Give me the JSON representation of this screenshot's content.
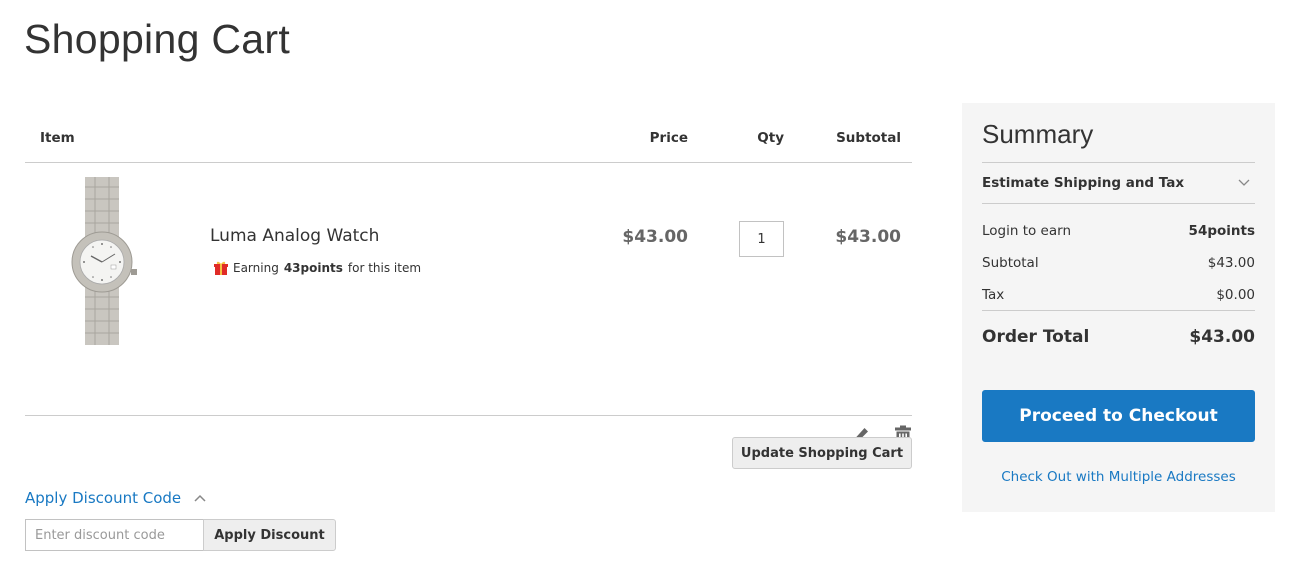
{
  "page": {
    "title": "Shopping Cart"
  },
  "cart": {
    "headers": {
      "item": "Item",
      "price": "Price",
      "qty": "Qty",
      "subtotal": "Subtotal"
    },
    "items": [
      {
        "name": "Luma Analog Watch",
        "image_alt": "Luma Analog Watch",
        "earn_prefix": "Earning",
        "earn_points": "43points",
        "earn_suffix": "for this item",
        "price": "$43.00",
        "qty": "1",
        "subtotal": "$43.00",
        "actions": {
          "edit_icon": "pencil-icon",
          "delete_icon": "trash-icon"
        }
      }
    ],
    "update_button": "Update Shopping Cart"
  },
  "discount": {
    "title": "Apply Discount Code",
    "expanded": true,
    "placeholder": "Enter discount code",
    "value": "",
    "apply_button": "Apply Discount"
  },
  "summary": {
    "title": "Summary",
    "estimate_label": "Estimate Shipping and Tax",
    "rows": [
      {
        "label": "Login to earn",
        "value": "54points"
      },
      {
        "label": "Subtotal",
        "value": "$43.00"
      },
      {
        "label": "Tax",
        "value": "$0.00"
      }
    ],
    "order_total_label": "Order Total",
    "order_total_value": "$43.00",
    "checkout_button": "Proceed to Checkout",
    "multi_address_link": "Check Out with Multiple Addresses"
  },
  "colors": {
    "accent": "#1979c3",
    "summary_bg": "#f5f5f5",
    "button_bg": "#eeeeee",
    "divider": "#cccccc",
    "price_text": "#666666"
  }
}
